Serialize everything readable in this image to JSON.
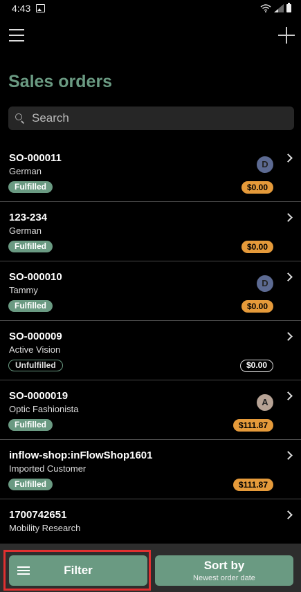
{
  "status_bar": {
    "time": "4:43"
  },
  "page": {
    "title": "Sales orders"
  },
  "search": {
    "placeholder": "Search"
  },
  "orders": [
    {
      "id": "SO-000011",
      "customer": "German",
      "status": "Fulfilled",
      "price": "$0.00",
      "avatar": "D",
      "avatar_color": "#5c6a92",
      "price_style": "orange"
    },
    {
      "id": "123-234",
      "customer": "German",
      "status": "Fulfilled",
      "price": "$0.00",
      "avatar": "",
      "avatar_color": "",
      "price_style": "orange"
    },
    {
      "id": "SO-000010",
      "customer": "Tammy",
      "status": "Fulfilled",
      "price": "$0.00",
      "avatar": "D",
      "avatar_color": "#5c6a92",
      "price_style": "orange"
    },
    {
      "id": "SO-000009",
      "customer": "Active Vision",
      "status": "Unfulfilled",
      "price": "$0.00",
      "avatar": "",
      "avatar_color": "",
      "price_style": "outline"
    },
    {
      "id": "SO-0000019",
      "customer": "Optic Fashionista",
      "status": "Fulfilled",
      "price": "$111.87",
      "avatar": "A",
      "avatar_color": "#b7a395",
      "price_style": "orange"
    },
    {
      "id": "inflow-shop:inFlowShop1601",
      "customer": "Imported Customer",
      "status": "Fulfilled",
      "price": "$111.87",
      "avatar": "",
      "avatar_color": "",
      "price_style": "orange"
    },
    {
      "id": "1700742651",
      "customer": "Mobility Research",
      "status": "",
      "price": "",
      "avatar": "",
      "avatar_color": "",
      "price_style": "outline"
    }
  ],
  "bottom_bar": {
    "filter_label": "Filter",
    "sort_label": "Sort by",
    "sort_value": "Newest order date"
  },
  "colors": {
    "accent": "#6a9a82",
    "price_badge": "#e59a3a",
    "highlight": "#e03030"
  }
}
